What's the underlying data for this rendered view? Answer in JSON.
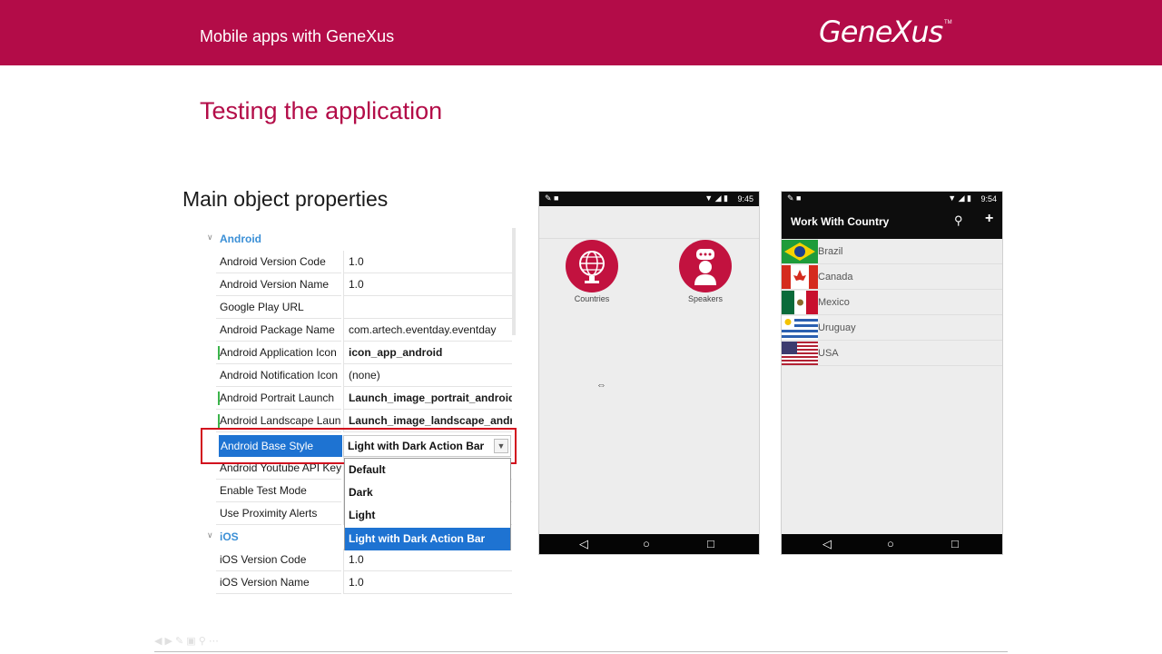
{
  "header": {
    "title": "Mobile apps with GeneXus",
    "logo": "GeneXus",
    "logo_tm": "TM"
  },
  "slide": {
    "title": "Testing the application",
    "section": "Main object properties"
  },
  "property_grid": {
    "categories": {
      "android": "Android",
      "ios": "iOS"
    },
    "rows": [
      {
        "name": "Android Version Code",
        "value": "1.0"
      },
      {
        "name": "Android Version Name",
        "value": "1.0"
      },
      {
        "name": "Google Play URL",
        "value": ""
      },
      {
        "name": "Android Package Name",
        "value": "com.artech.eventday.eventday"
      },
      {
        "name": "Android Application Icon",
        "value": "icon_app_android"
      },
      {
        "name": "Android Notification Icon",
        "value": "(none)"
      },
      {
        "name": "Android Portrait Launch",
        "value": "Launch_image_portrait_android"
      },
      {
        "name": "Android Landscape Launch",
        "value": "Launch_image_landscape_andr"
      },
      {
        "name": "Android Youtube API Key",
        "value": ""
      },
      {
        "name": "Enable Test Mode",
        "value": ""
      },
      {
        "name": "Use Proximity Alerts",
        "value": ""
      }
    ],
    "ios_rows": [
      {
        "name": "iOS Version Code",
        "value": "1.0"
      },
      {
        "name": "iOS Version Name",
        "value": "1.0"
      }
    ],
    "selected": {
      "name": "Android Base Style",
      "value": "Light with Dark Action Bar"
    },
    "dropdown_options": [
      "Default",
      "Dark",
      "Light",
      "Light with Dark Action Bar"
    ]
  },
  "phone1": {
    "time": "9:45",
    "tiles": [
      {
        "label": "Countries"
      },
      {
        "label": "Speakers"
      }
    ]
  },
  "phone2": {
    "time": "9:54",
    "title": "Work With Country",
    "countries": [
      "Brazil",
      "Canada",
      "Mexico",
      "Uruguay",
      "USA"
    ]
  },
  "colors": {
    "brand": "#b30c48",
    "selection": "#1e73d2",
    "highlight_box": "#d20f1e"
  }
}
